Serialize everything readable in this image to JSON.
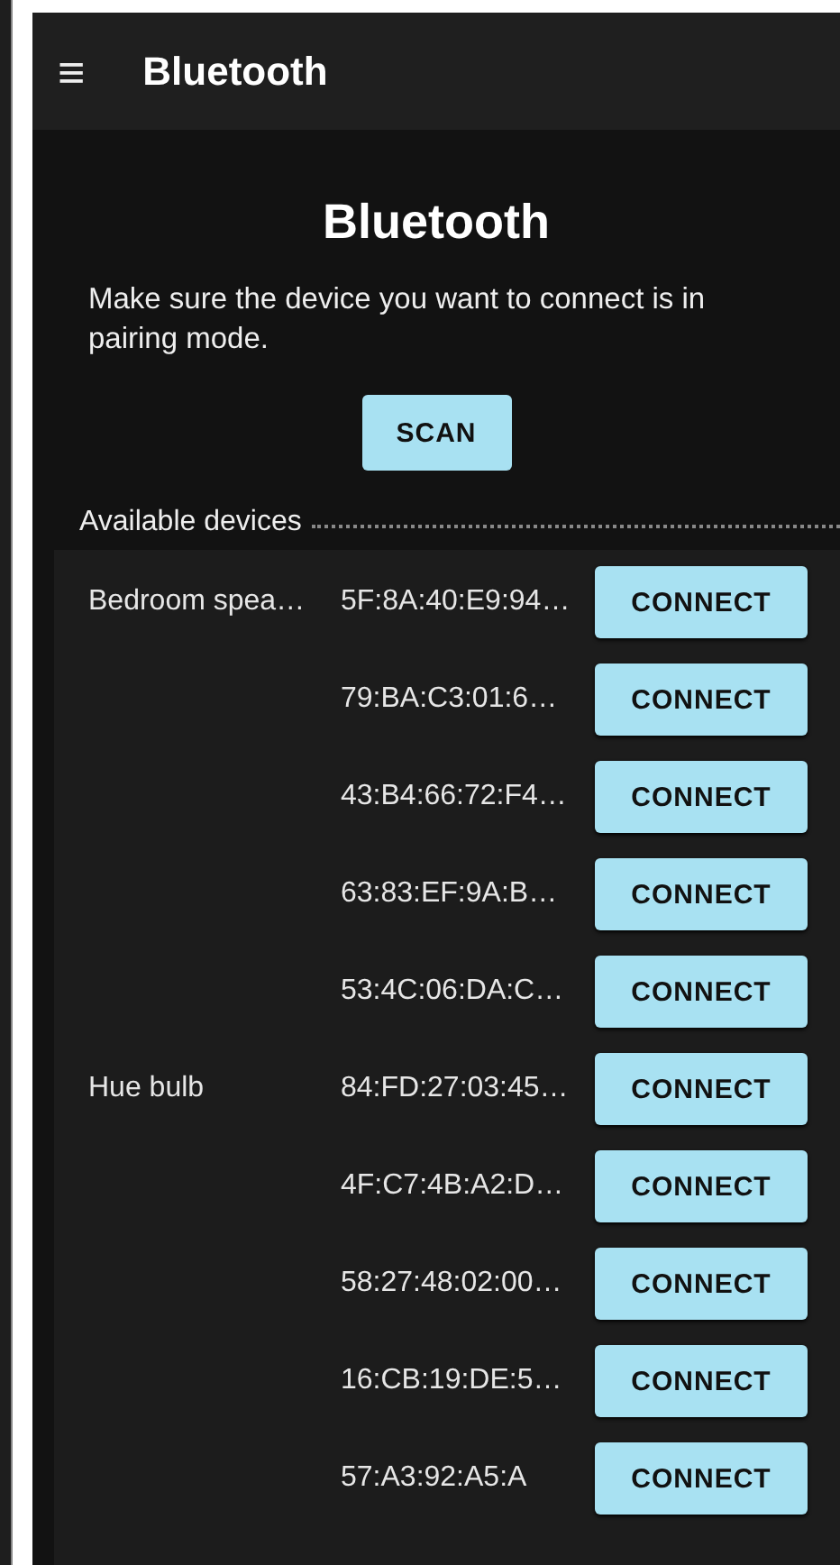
{
  "app_bar": {
    "title": "Bluetooth",
    "menu_icon": "≡"
  },
  "heading": "Bluetooth",
  "instructions": "Make sure the device you want to connect is in pairing mode.",
  "scan_button": "SCAN",
  "section_label": "Available devices",
  "devices": [
    {
      "name": "Bedroom spea…",
      "address": "5F:8A:40:E9:94…",
      "button": "CONNECT"
    },
    {
      "address": "79:BA:C3:01:6…",
      "button": "CONNECT"
    },
    {
      "address": "43:B4:66:72:F4…",
      "button": "CONNECT"
    },
    {
      "address": "63:83:EF:9A:B…",
      "button": "CONNECT"
    },
    {
      "address": "53:4C:06:DA:C…",
      "button": "CONNECT"
    },
    {
      "name": "Hue bulb",
      "address": "84:FD:27:03:45…",
      "button": "CONNECT"
    },
    {
      "address": "4F:C7:4B:A2:D…",
      "button": "CONNECT"
    },
    {
      "address": "58:27:48:02:00…",
      "button": "CONNECT"
    },
    {
      "address": "16:CB:19:DE:5…",
      "button": "CONNECT"
    },
    {
      "address": "57:A3:92:A5:A",
      "button": "CONNECT"
    }
  ]
}
